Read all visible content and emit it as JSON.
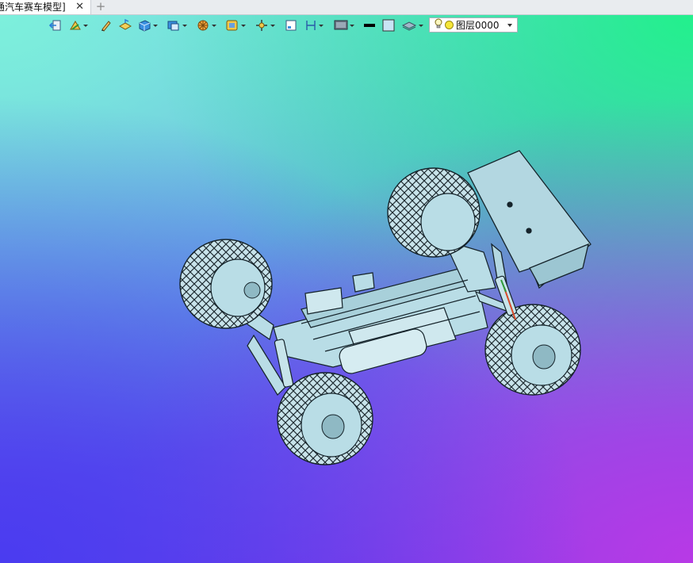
{
  "tabbar": {
    "active_tab_label": "通汽车赛车模型]",
    "close_glyph": "✕",
    "add_glyph": "+"
  },
  "toolbar": {
    "buttons": [
      {
        "name": "exit-icon",
        "has_menu": false
      },
      {
        "name": "sketch-icon",
        "has_menu": true
      },
      {
        "name": "pencil-icon",
        "has_menu": false
      },
      {
        "name": "extrude-icon",
        "has_menu": false
      },
      {
        "name": "solid-box-icon",
        "has_menu": true
      },
      {
        "name": "shell-icon",
        "has_menu": true
      },
      {
        "name": "revolve-icon",
        "has_menu": true
      },
      {
        "name": "view-face-icon",
        "has_menu": true
      },
      {
        "name": "move-icon",
        "has_menu": true
      },
      {
        "name": "frame-icon",
        "has_menu": false
      },
      {
        "name": "dimension-icon",
        "has_menu": true
      },
      {
        "name": "display-icon",
        "has_menu": true
      },
      {
        "name": "line-color-icon",
        "has_menu": false
      },
      {
        "name": "fill-color-icon",
        "has_menu": false
      },
      {
        "name": "layer-stack-icon",
        "has_menu": true
      }
    ],
    "layer": {
      "label": "图层0000",
      "color": "#f5e63a"
    }
  },
  "viewport": {
    "content": "3D model of a monster-truck RC car chassis",
    "bg_colors": [
      "#7df0dc",
      "#22f08c",
      "#4a3cf0",
      "#b83ae6"
    ],
    "model_color": "#b9dde6"
  }
}
